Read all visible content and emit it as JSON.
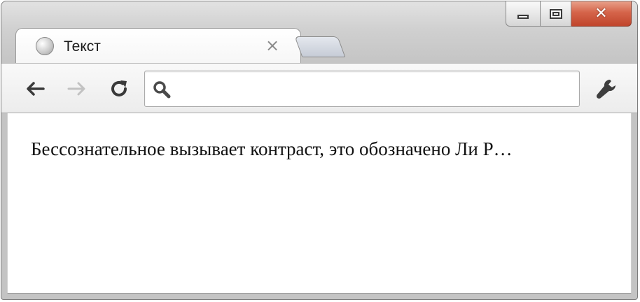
{
  "tab": {
    "title": "Текст",
    "close_glyph": "×",
    "favicon": "globe-icon"
  },
  "window_controls": {
    "close_glyph": "✕"
  },
  "toolbar": {
    "back_icon": "arrow-left-icon",
    "forward_icon": "arrow-right-icon",
    "reload_icon": "reload-icon",
    "menu_icon": "wrench-icon",
    "omnibox_value": "",
    "omnibox_icon": "search-icon"
  },
  "page": {
    "text": "Бессознательное вызывает контраст, это обозначено Ли Р…"
  },
  "colors": {
    "close_button": "#c9503a",
    "page_background": "#ffffff"
  }
}
